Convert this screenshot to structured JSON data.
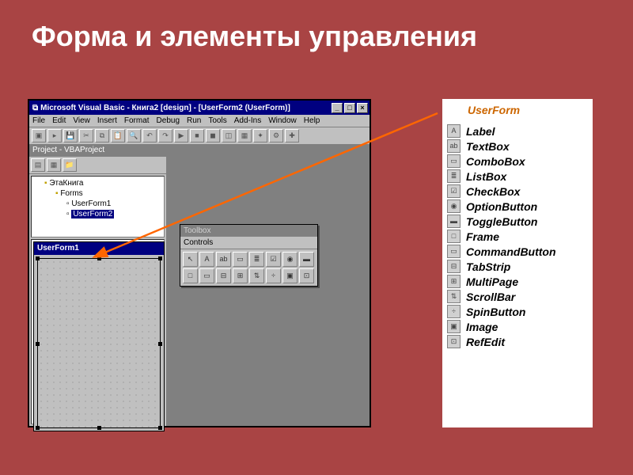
{
  "slide": {
    "title": "Форма и элементы управления"
  },
  "ide": {
    "title": "Microsoft Visual Basic - Книга2 [design] - [UserForm2 (UserForm)]",
    "menu": [
      "File",
      "Edit",
      "View",
      "Insert",
      "Format",
      "Debug",
      "Run",
      "Tools",
      "Add-Ins",
      "Window",
      "Help"
    ],
    "project_pane_title": "Project - VBAProject",
    "tree": {
      "root": "ЭтаКнига",
      "folder": "Forms",
      "item1": "UserForm1",
      "item2": "UserForm2"
    },
    "form_title": "UserForm1",
    "toolbox_title": "Toolbox",
    "toolbox_tab": "Controls"
  },
  "controls": {
    "heading": "UserForm",
    "items": [
      {
        "icon": "A",
        "name": "Label"
      },
      {
        "icon": "ab",
        "name": "TextBox"
      },
      {
        "icon": "▭",
        "name": "ComboBox"
      },
      {
        "icon": "≣",
        "name": "ListBox"
      },
      {
        "icon": "☑",
        "name": "CheckBox"
      },
      {
        "icon": "◉",
        "name": "OptionButton"
      },
      {
        "icon": "▬",
        "name": "ToggleButton"
      },
      {
        "icon": "□",
        "name": "Frame"
      },
      {
        "icon": "▭",
        "name": "CommandButton"
      },
      {
        "icon": "⊟",
        "name": "TabStrip"
      },
      {
        "icon": "⊞",
        "name": "MultiPage"
      },
      {
        "icon": "⇅",
        "name": "ScrollBar"
      },
      {
        "icon": "÷",
        "name": "SpinButton"
      },
      {
        "icon": "▣",
        "name": "Image"
      },
      {
        "icon": "⊡",
        "name": "RefEdit"
      }
    ]
  }
}
